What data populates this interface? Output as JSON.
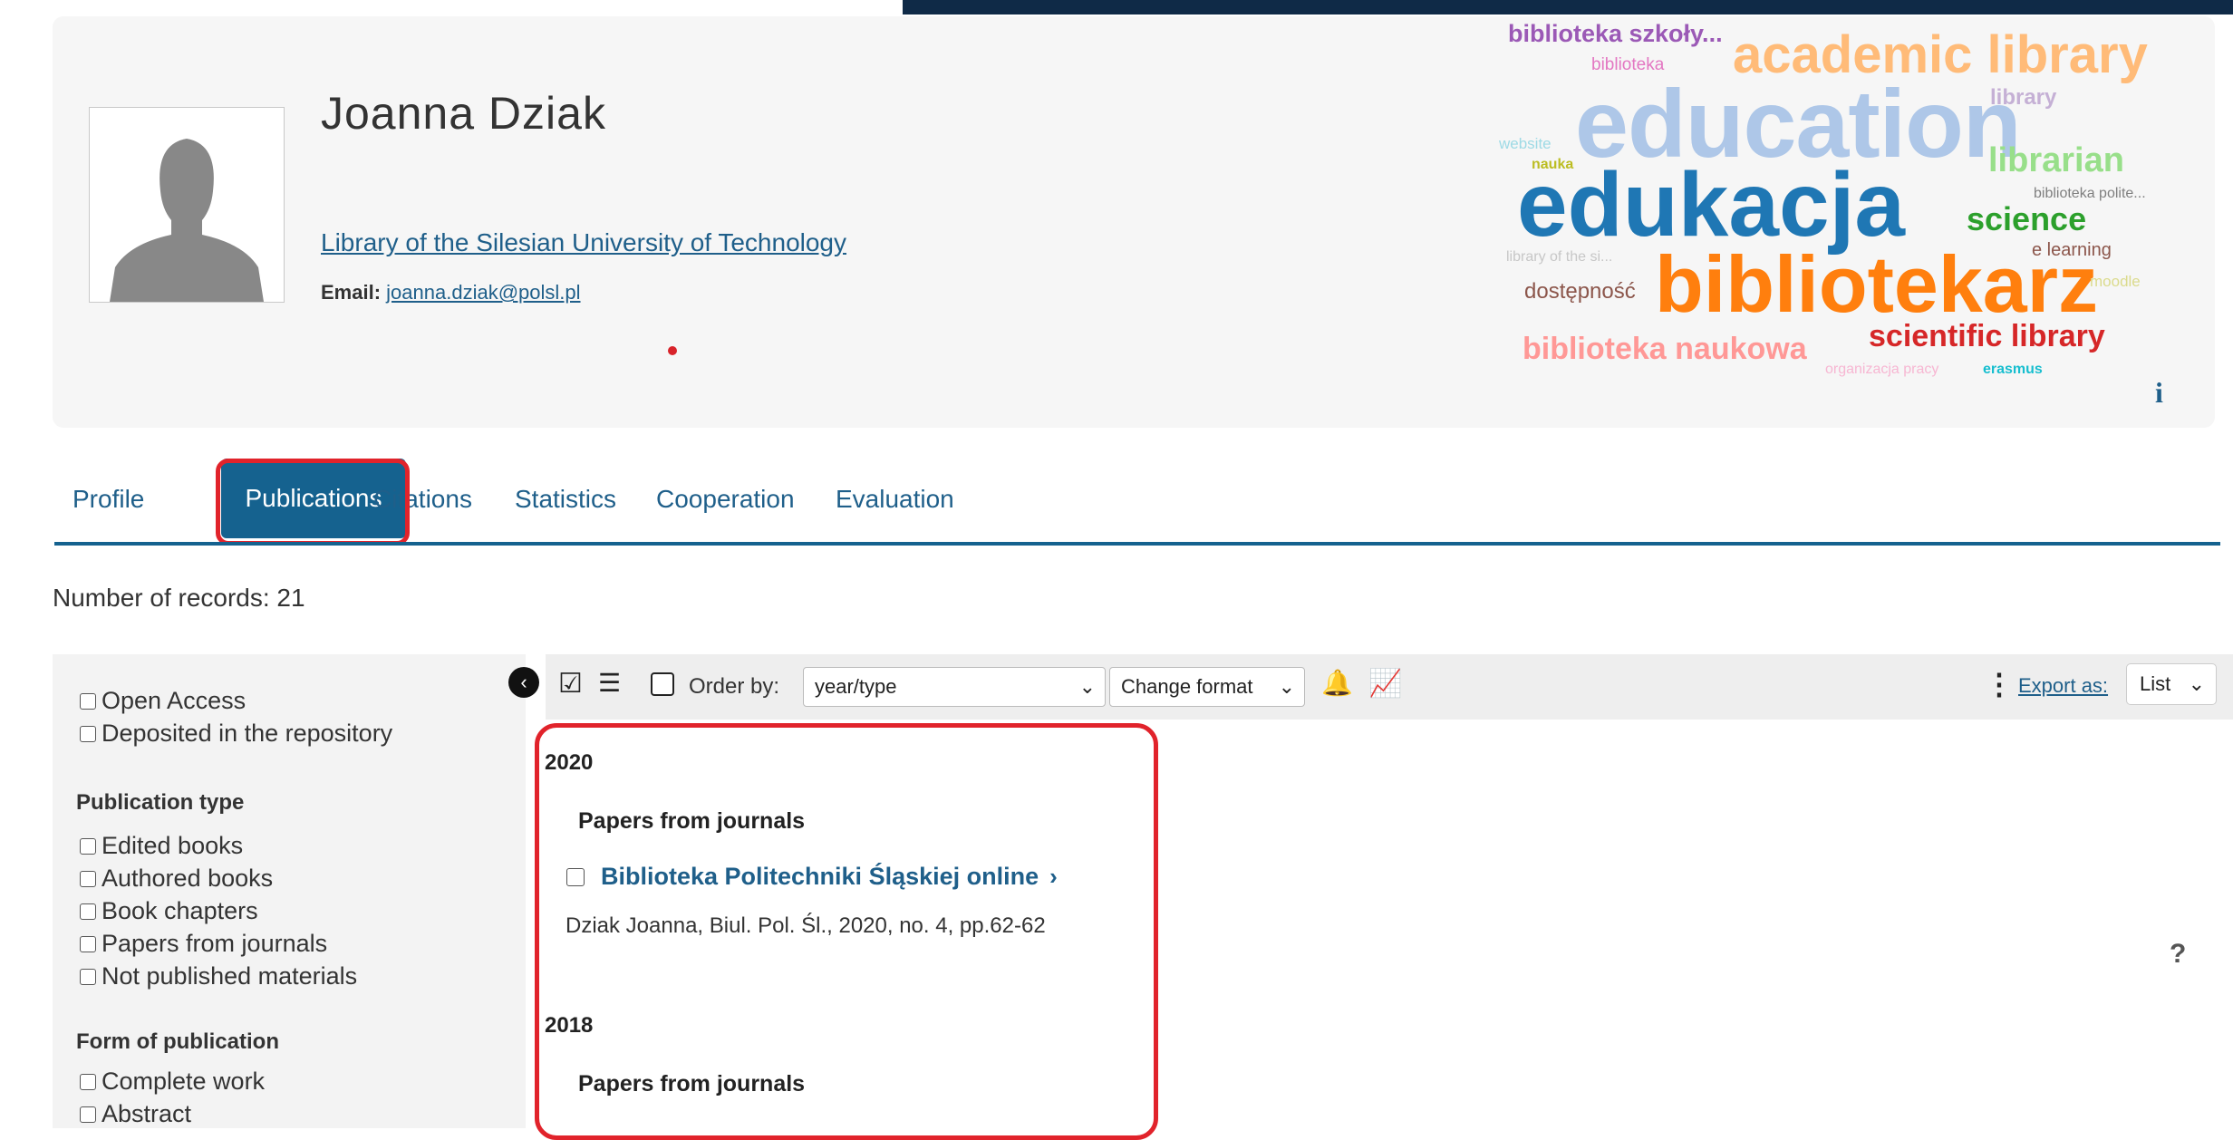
{
  "profile": {
    "name": "Joanna Dziak",
    "affiliation": "Library of the Silesian University of Technology",
    "email_label": "Email:",
    "email": "joanna.dziak@polsl.pl"
  },
  "word_cloud": [
    {
      "text": "biblioteka szkoły...",
      "color": "#9b59b6"
    },
    {
      "text": "biblioteka",
      "color": "#e377c2"
    },
    {
      "text": "academic library",
      "color": "#ffbb78"
    },
    {
      "text": "library",
      "color": "#c5b0d5"
    },
    {
      "text": "website",
      "color": "#9edae5"
    },
    {
      "text": "education",
      "color": "#aec7e8"
    },
    {
      "text": "nauka",
      "color": "#bcbd22"
    },
    {
      "text": "librarian",
      "color": "#98df8a"
    },
    {
      "text": "biblioteka polite...",
      "color": "#7f7f7f"
    },
    {
      "text": "edukacja",
      "color": "#1f77b4"
    },
    {
      "text": "science",
      "color": "#2ca02c"
    },
    {
      "text": "library of the si...",
      "color": "#c7c7c7"
    },
    {
      "text": "e learning",
      "color": "#8c564b"
    },
    {
      "text": "dostępność",
      "color": "#8c564b"
    },
    {
      "text": "bibliotekarz",
      "color": "#ff7f0e"
    },
    {
      "text": "moodle",
      "color": "#dbdb8d"
    },
    {
      "text": "biblioteka naukowa",
      "color": "#ff9896"
    },
    {
      "text": "scientific library",
      "color": "#d62728"
    },
    {
      "text": "organizacja pracy",
      "color": "#f7b6d2"
    },
    {
      "text": "erasmus",
      "color": "#17becf"
    }
  ],
  "info_icon": "i",
  "tabs": [
    {
      "label": "Profile"
    },
    {
      "label": "Publications",
      "active": true
    },
    {
      "label": "Citations"
    },
    {
      "label": "Statistics"
    },
    {
      "label": "Cooperation"
    },
    {
      "label": "Evaluation"
    }
  ],
  "records_text": "Number of records: 21",
  "filters": {
    "access": [
      "Open Access",
      "Deposited in the repository"
    ],
    "publication_type_heading": "Publication type",
    "publication_types": [
      "Edited books",
      "Authored books",
      "Book chapters",
      "Papers from journals",
      "Not published materials"
    ],
    "form_heading": "Form of publication",
    "forms": [
      "Complete work",
      "Abstract"
    ]
  },
  "toolbar": {
    "order_label": "Order by:",
    "order_value": "year/type",
    "format_value": "Change format",
    "export_label": "Export as:",
    "list_value": "List"
  },
  "results": [
    {
      "year": "2020",
      "group": "Papers from journals",
      "title": "Biblioteka Politechniki Śląskiej online",
      "meta": "Dziak Joanna, Biul. Pol. Śl., 2020, no. 4, pp.62-62"
    },
    {
      "year": "2018",
      "group": "Papers from journals"
    }
  ],
  "help_icon": "?",
  "highlight_color": "#e1232b",
  "accent_color": "#15628f"
}
